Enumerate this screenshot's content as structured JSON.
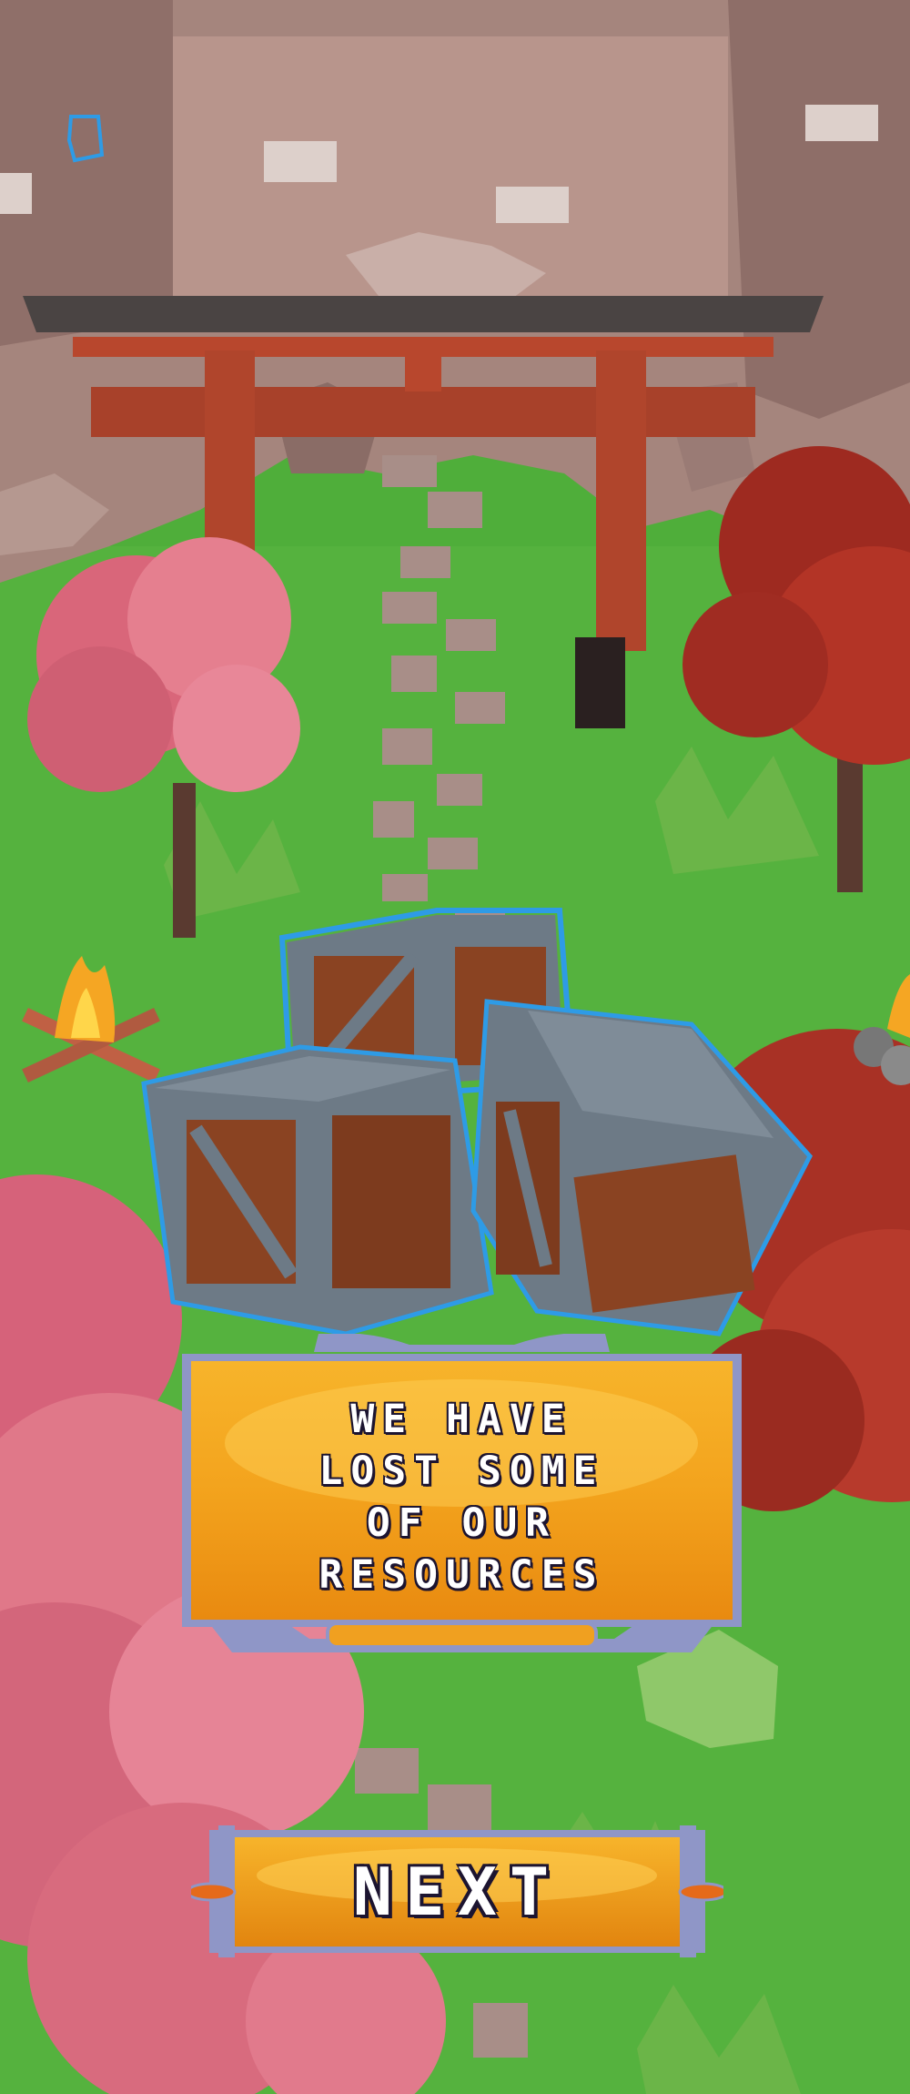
{
  "dialog": {
    "message_lines": [
      "WE HAVE",
      "LOST SOME",
      "OF OUR",
      "RESOURCES"
    ],
    "next_label": "NEXT"
  },
  "colors": {
    "grass": "#4fae3a",
    "cliff": "#a88880",
    "torii": "#b8472d",
    "panel_orange": "#f0a020",
    "panel_frame": "#8f96c7",
    "crate_metal": "#6d7a86",
    "crate_wood": "#8a4322",
    "highlight_blue": "#2e9be6",
    "text": "#ffffff"
  },
  "scene": {
    "icons": [
      "torii-gate-icon",
      "cherry-tree-icon",
      "maple-tree-icon",
      "campfire-icon",
      "crate-icon",
      "rock-icon"
    ]
  }
}
